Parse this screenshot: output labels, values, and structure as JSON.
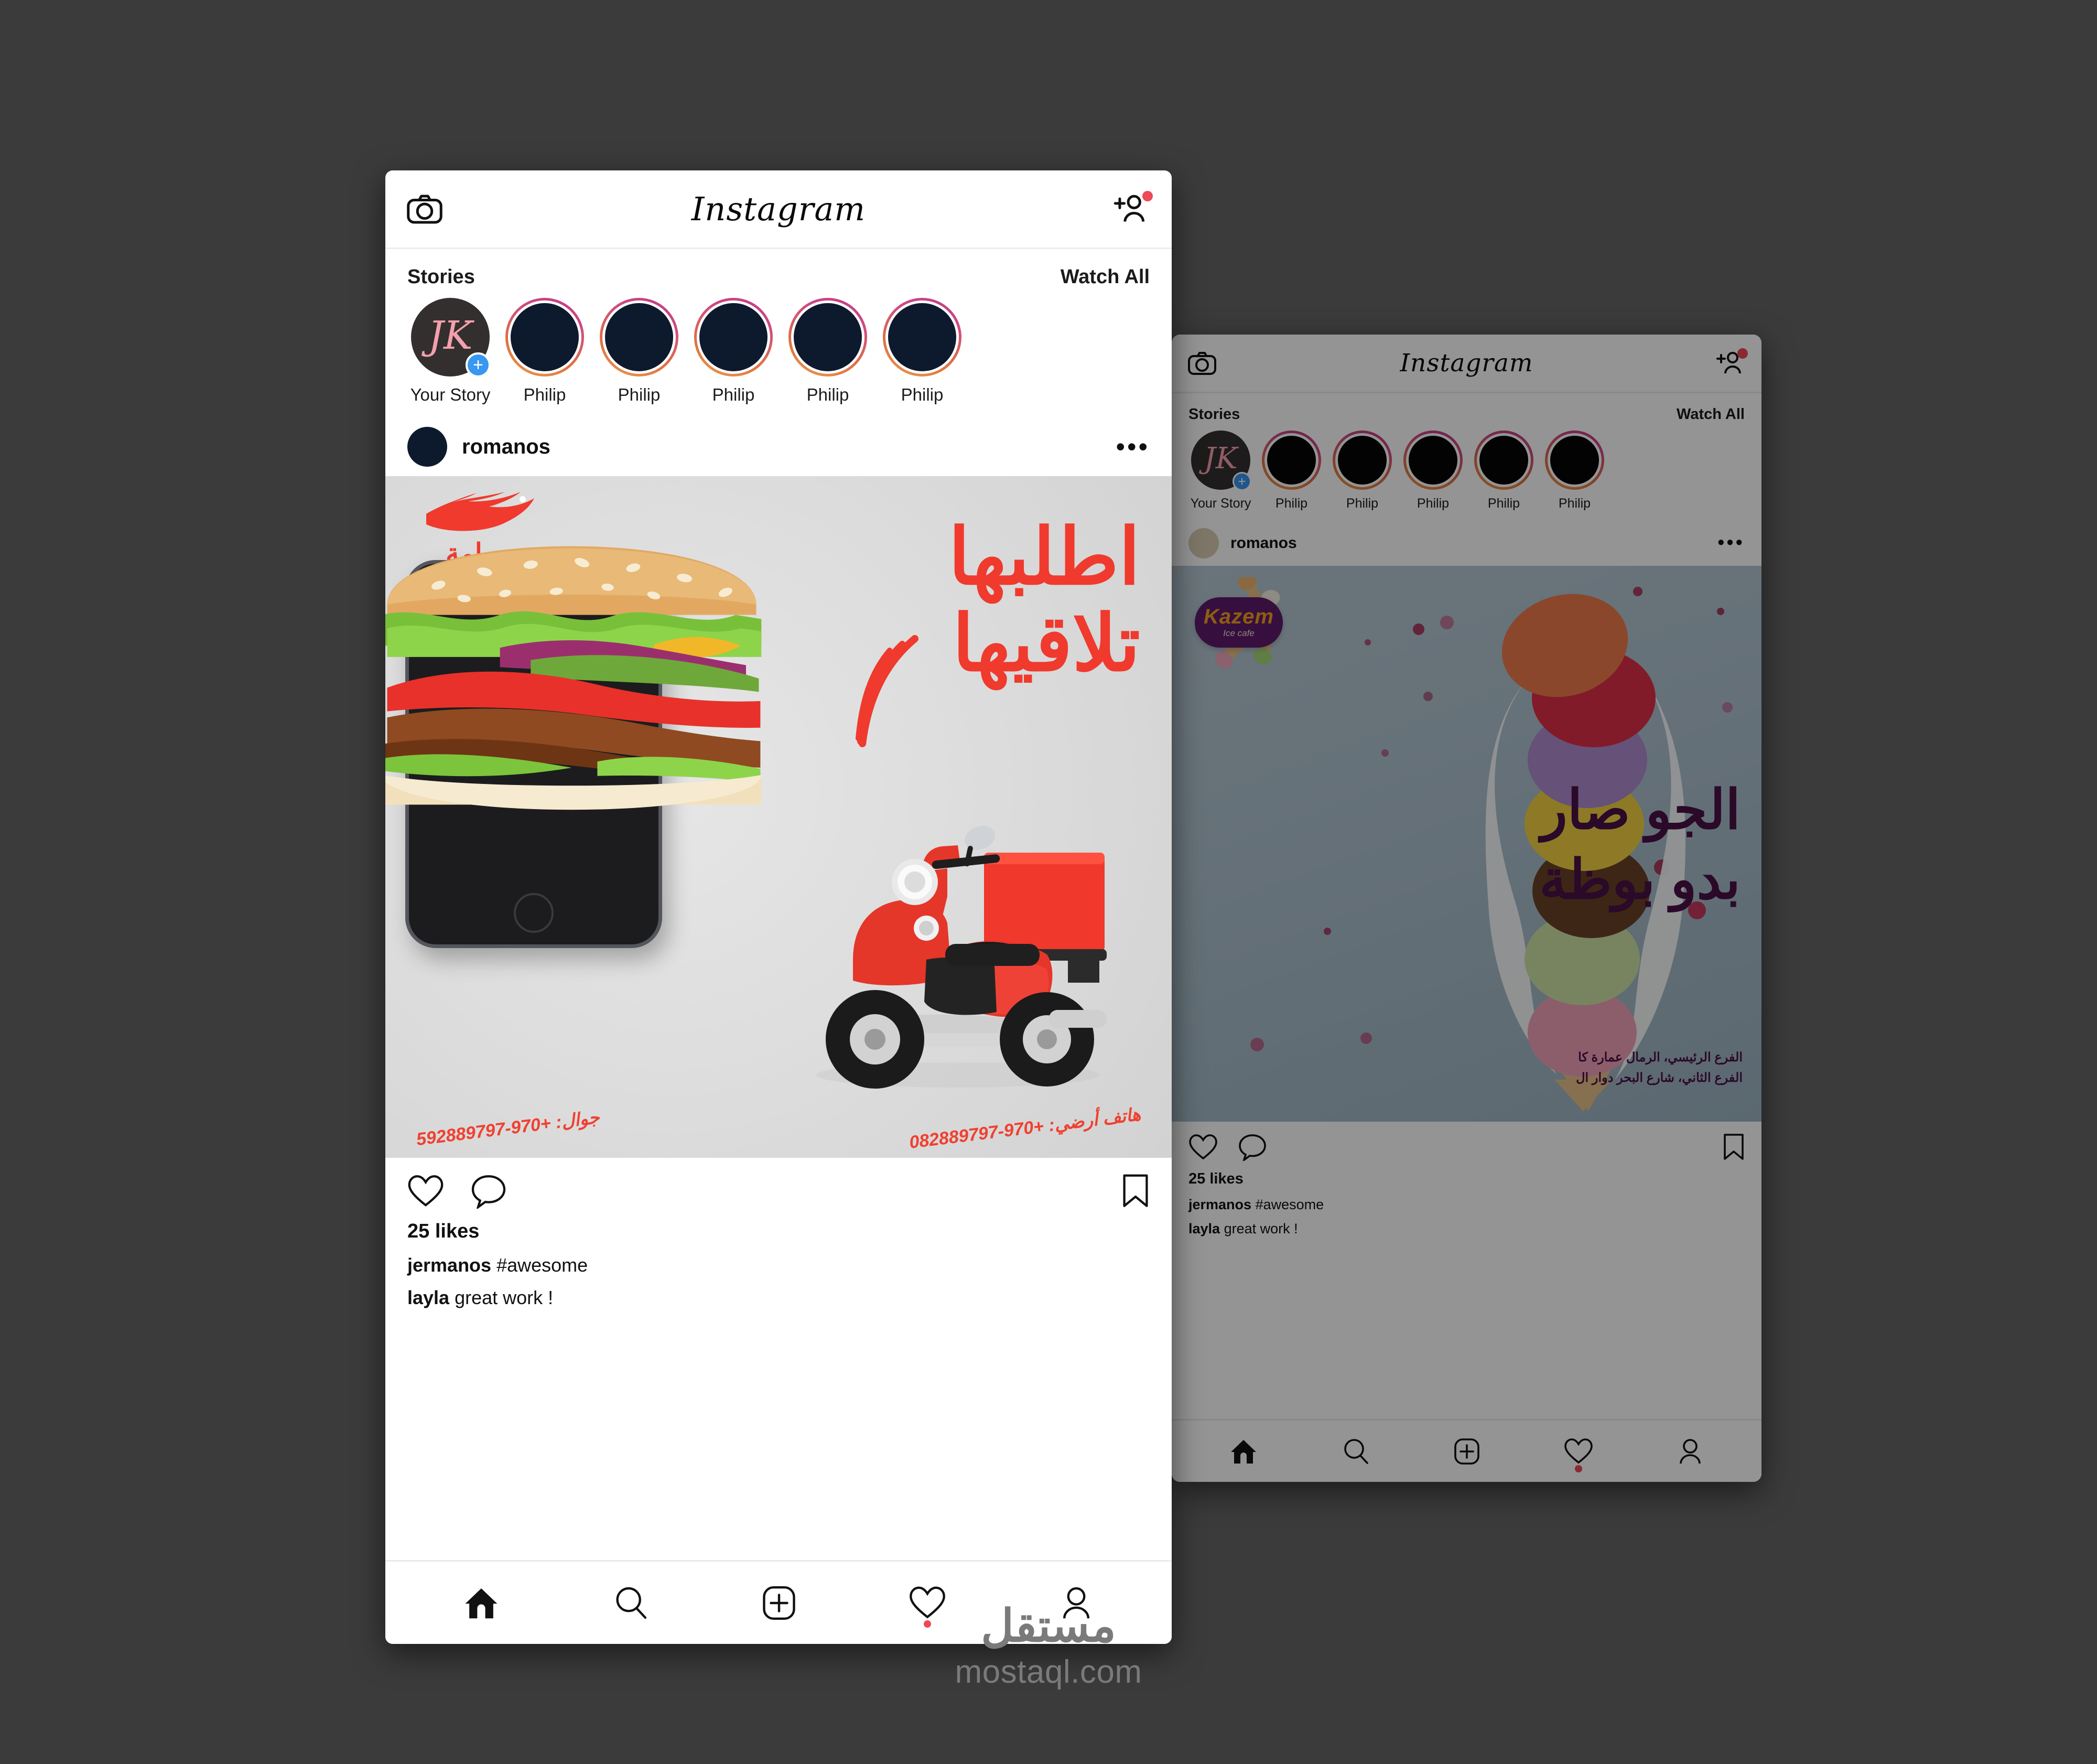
{
  "app": {
    "name": "Instagram",
    "logo_text": "Instagram"
  },
  "window_front": {
    "topbar": {
      "camera_icon": "camera-icon",
      "title": "Instagram",
      "add_person_icon": "add-person-icon"
    },
    "stories": {
      "title": "Stories",
      "watch_all": "Watch All",
      "items": [
        {
          "label": "Your Story",
          "monogram": "JK",
          "self": true,
          "has_ring": false
        },
        {
          "label": "Philip",
          "self": false,
          "has_ring": true
        },
        {
          "label": "Philip",
          "self": false,
          "has_ring": true
        },
        {
          "label": "Philip",
          "self": false,
          "has_ring": true
        },
        {
          "label": "Philip",
          "self": false,
          "has_ring": true
        },
        {
          "label": "Philip",
          "self": false,
          "has_ring": true
        }
      ]
    },
    "post": {
      "username": "romanos",
      "more_glyph": "•••",
      "creative": {
        "brand_name_ar": "يمامة",
        "headline_line1": "اطلبها",
        "headline_line2": "تلاقيها",
        "landline_label": "هاتف أرضي:",
        "landline_number": "+970-082889797",
        "mobile_label": "جوال:",
        "mobile_number": "+970-592889797"
      },
      "likes": "25 likes",
      "comments": [
        {
          "user": "jermanos",
          "text": " #awesome"
        },
        {
          "user": "layla",
          "text": " great work !"
        }
      ],
      "action_icons": [
        "heart-icon",
        "comment-icon",
        "bookmark-icon"
      ]
    },
    "tabbar": {
      "items": [
        {
          "icon": "home-icon",
          "active": true,
          "notif": false
        },
        {
          "icon": "search-icon",
          "active": false,
          "notif": false
        },
        {
          "icon": "add-post-icon",
          "active": false,
          "notif": false
        },
        {
          "icon": "activity-heart-icon",
          "active": false,
          "notif": true
        },
        {
          "icon": "profile-icon",
          "active": false,
          "notif": false
        }
      ]
    }
  },
  "window_back": {
    "topbar": {
      "camera_icon": "camera-icon",
      "title": "Instagram",
      "add_person_icon": "add-person-icon"
    },
    "stories": {
      "title": "Stories",
      "watch_all": "Watch All",
      "items": [
        {
          "label": "Your Story",
          "monogram": "JK",
          "self": true,
          "has_ring": false
        },
        {
          "label": "Philip",
          "self": false,
          "has_ring": true
        },
        {
          "label": "Philip",
          "self": false,
          "has_ring": true
        },
        {
          "label": "Philip",
          "self": false,
          "has_ring": true
        },
        {
          "label": "Philip",
          "self": false,
          "has_ring": true
        },
        {
          "label": "Philip",
          "self": false,
          "has_ring": true
        }
      ]
    },
    "post": {
      "username": "romanos",
      "more_glyph": "•••",
      "creative": {
        "brand_name": "Kazem",
        "brand_tagline": "Ice cafe",
        "headline_line1": "الجو صار",
        "headline_line2": "بدو بوظة",
        "address_line1": "الفرع الرئيسي، الرمال عمارة كا",
        "address_line2": "الفرع الثاني، شارع البحر دوار ال"
      },
      "likes": "25 likes",
      "comments": [
        {
          "user": "jermanos",
          "text": " #awesome"
        },
        {
          "user": "layla",
          "text": " great work !"
        }
      ]
    },
    "tabbar": {
      "items": [
        {
          "icon": "home-icon",
          "active": true,
          "notif": false
        },
        {
          "icon": "search-icon",
          "active": false,
          "notif": false
        },
        {
          "icon": "add-post-icon",
          "active": false,
          "notif": false
        },
        {
          "icon": "activity-heart-icon",
          "active": false,
          "notif": true
        },
        {
          "icon": "profile-icon",
          "active": false,
          "notif": false
        }
      ]
    }
  },
  "watermark": {
    "arabic": "مستقل",
    "latin": "mostaql.com"
  },
  "colors": {
    "page_background": "#3b3b3b",
    "story_ring_start": "#c0388c",
    "story_ring_end": "#ec9a50",
    "story_avatar": "#0d1a2e",
    "plus_badge": "#3897f0",
    "notification_dot": "#ed4956",
    "brand_red": "#ef3a2d",
    "ice_purple": "#4a1148",
    "ice_background": "#aec2cf",
    "burger_bg": "#dcdcdc"
  }
}
